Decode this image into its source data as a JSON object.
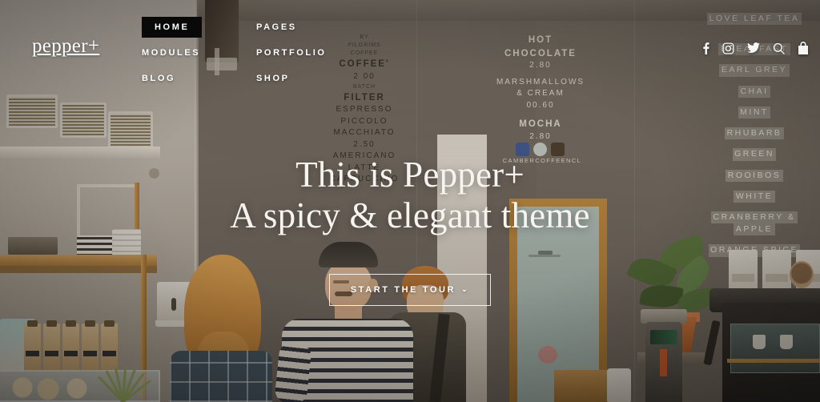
{
  "brand": {
    "logo": "pepper+"
  },
  "nav": {
    "columns": [
      {
        "items": [
          {
            "label": "HOME",
            "active": true
          },
          {
            "label": "MODULES",
            "active": false
          },
          {
            "label": "BLOG",
            "active": false
          }
        ]
      },
      {
        "items": [
          {
            "label": "PAGES",
            "active": false
          },
          {
            "label": "PORTFOLIO",
            "active": false
          },
          {
            "label": "SHOP",
            "active": false
          }
        ]
      }
    ]
  },
  "tools": [
    {
      "name": "facebook-icon",
      "label": "Facebook"
    },
    {
      "name": "instagram-icon",
      "label": "Instagram"
    },
    {
      "name": "twitter-icon",
      "label": "Twitter"
    },
    {
      "name": "search-icon",
      "label": "Search"
    },
    {
      "name": "shopping-bag-icon",
      "label": "Cart"
    }
  ],
  "hero": {
    "line1": "This is Pepper+",
    "line2": "A spicy & elegant theme",
    "cta_label": "START THE TOUR",
    "cta_chevron": "⌄"
  },
  "photo_text": {
    "coffee_menu": {
      "header_tiny": "BY\nPILGRIMS\nCOFFEE",
      "lines": [
        "COFFEE'",
        "2 00",
        "BATCH",
        "FILTER",
        "ESPRESSO",
        "PICCOLO",
        "MACCHIATO",
        "2.50",
        "AMERICANO",
        "LATTE",
        "CAPPUCCINO"
      ]
    },
    "chocolate_menu": {
      "lines": [
        "HOT",
        "CHOCOLATE",
        "2.80",
        "MARSHMALLOWS",
        "& CREAM",
        "00.60",
        "MOCHA",
        "2.80"
      ],
      "handle": "CAMBERCOFFEENCL"
    },
    "tea_menu": {
      "lines": [
        "LOVE LEAF TEA",
        "BREAKFAST",
        "EARL GREY",
        "CHAI",
        "MINT",
        "RHUBARB",
        "GREEN",
        "ROOIBOS",
        "WHITE",
        "CRANBERRY &",
        "APPLE",
        "ORANGE SPICE"
      ]
    }
  },
  "colors": {
    "nav_active_bg": "#090909",
    "text_light": "#ffffff",
    "hero_text": "#f7f4ef",
    "wall_warm": "#756d64",
    "wall_pale": "#c7c0b6",
    "accent_wood": "#c1873c"
  }
}
